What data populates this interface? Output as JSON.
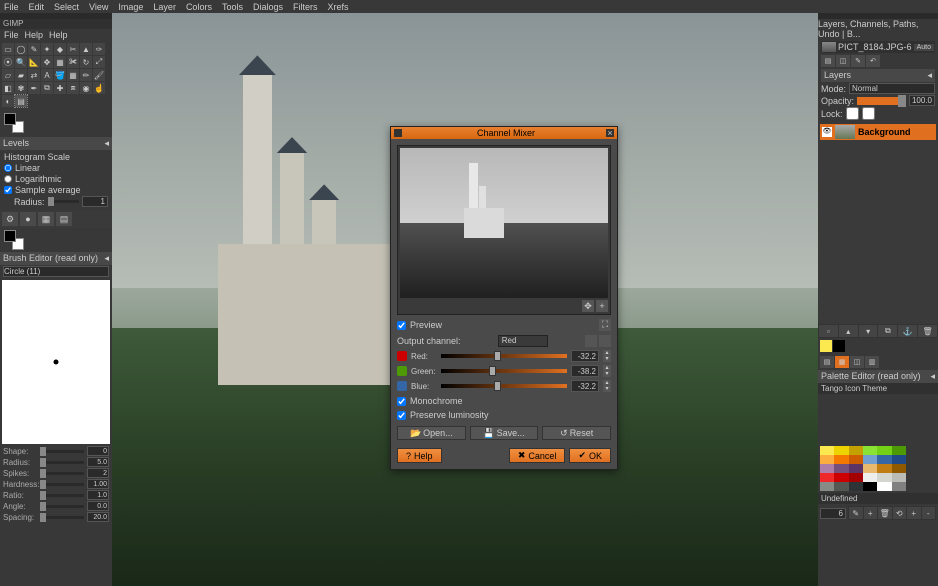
{
  "top_menu": [
    "File",
    "Edit",
    "Select",
    "View",
    "Image",
    "Layer",
    "Colors",
    "Tools",
    "Dialogs",
    "Filters",
    "Xrefs"
  ],
  "left_dock": {
    "title": "GIMP",
    "menu": [
      "File",
      "Help",
      "Help"
    ],
    "tool_options": {
      "title": "Levels",
      "histogram_scale": "Histogram Scale",
      "linear": "Linear",
      "logarithmic": "Logarithmic",
      "sample_average": "Sample average",
      "radius_label": "Radius:",
      "radius_value": "1"
    },
    "brush_editor_title": "Brush Editor (read only)",
    "brush_name": "Circle (11)",
    "sliders": [
      {
        "label": "Shape:",
        "value": "0"
      },
      {
        "label": "Radius:",
        "value": "5.0"
      },
      {
        "label": "Spikes:",
        "value": "2"
      },
      {
        "label": "Hardness:",
        "value": "1.00"
      },
      {
        "label": "Ratio:",
        "value": "1.0"
      },
      {
        "label": "Angle:",
        "value": "0.0"
      },
      {
        "label": "Spacing:",
        "value": "20.0"
      }
    ]
  },
  "right_dock": {
    "title": "Layers, Channels, Paths, Undo | B...",
    "image_name": "PICT_8184.JPG-6",
    "auto": "Auto",
    "layers_label": "Layers",
    "mode_label": "Mode:",
    "mode_value": "Normal",
    "opacity_label": "Opacity:",
    "opacity_value": "100.0",
    "lock_label": "Lock:",
    "layer_name": "Background",
    "palette_title": "Palette Editor (read only)",
    "palette_name": "Tango Icon Theme",
    "palette_colors": [
      "#fce94f",
      "#edd400",
      "#c4a000",
      "#8ae234",
      "#73d216",
      "#4e9a06",
      "#fcaf3e",
      "#f57900",
      "#ce5c00",
      "#729fcf",
      "#3465a4",
      "#204a87",
      "#ad7fa8",
      "#75507b",
      "#5c3566",
      "#e9b96e",
      "#c17d11",
      "#8f5902",
      "#ef2929",
      "#cc0000",
      "#a40000",
      "#eeeeec",
      "#d3d7cf",
      "#babdb6",
      "#888a85",
      "#555753",
      "#2e3436",
      "#000000",
      "#ffffff",
      "#808080"
    ],
    "undefined": "Undefined",
    "col_count": "6"
  },
  "dialog": {
    "title": "Channel Mixer",
    "preview": "Preview",
    "output_channel": "Output channel:",
    "output_value": "Red",
    "channels": [
      {
        "name": "Red:",
        "value": "-32.2",
        "color": "#cc0000",
        "pos": 42
      },
      {
        "name": "Green:",
        "value": "-38.2",
        "color": "#4e9a06",
        "pos": 38
      },
      {
        "name": "Blue:",
        "value": "-32.2",
        "color": "#3465a4",
        "pos": 42
      }
    ],
    "monochrome": "Monochrome",
    "preserve_lum": "Preserve luminosity",
    "open": "Open...",
    "save": "Save...",
    "reset": "Reset",
    "help": "Help",
    "cancel": "Cancel",
    "ok": "OK"
  }
}
